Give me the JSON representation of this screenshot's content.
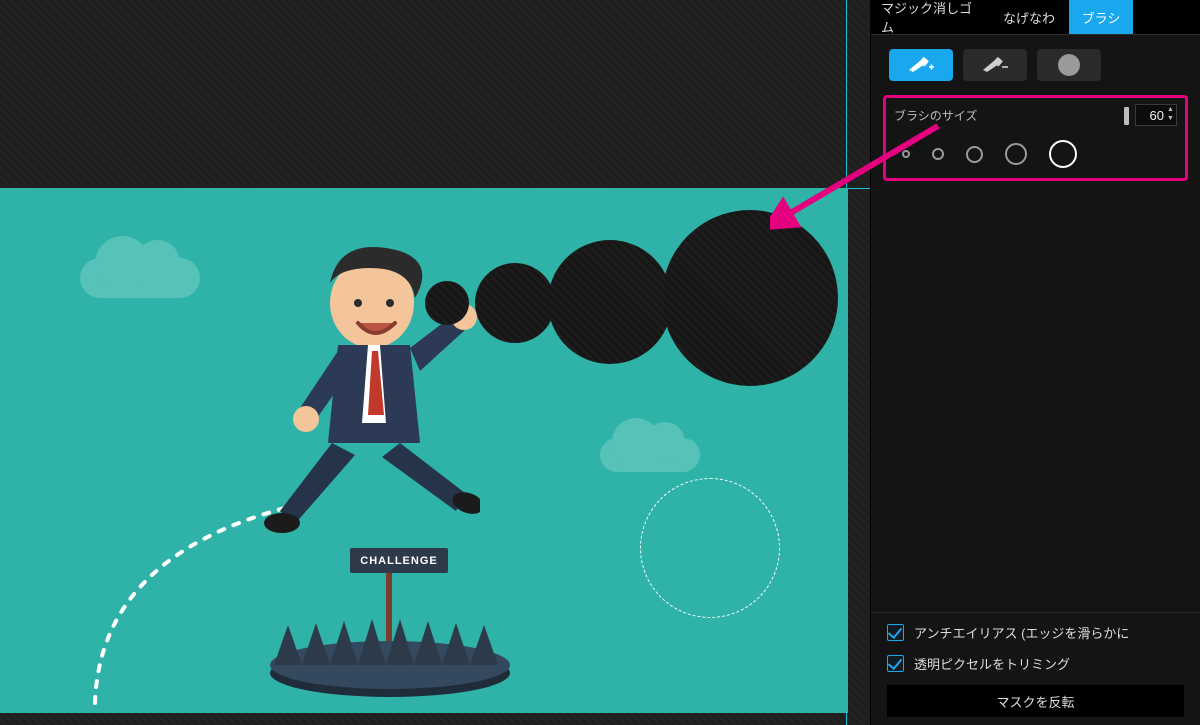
{
  "tabs": {
    "magic": "マジック消しゴム",
    "lasso": "なげなわ",
    "brush": "ブラシ",
    "active": "brush"
  },
  "brush": {
    "size_label": "ブラシのサイズ",
    "size_value": "60",
    "presets_selected": 4
  },
  "checks": {
    "antialias": "アンチエイリアス (エッジを滑らかに",
    "trim": "透明ピクセルをトリミング"
  },
  "buttons": {
    "invert": "マスクを反転"
  },
  "canvas": {
    "sign_text": "CHALLENGE"
  }
}
